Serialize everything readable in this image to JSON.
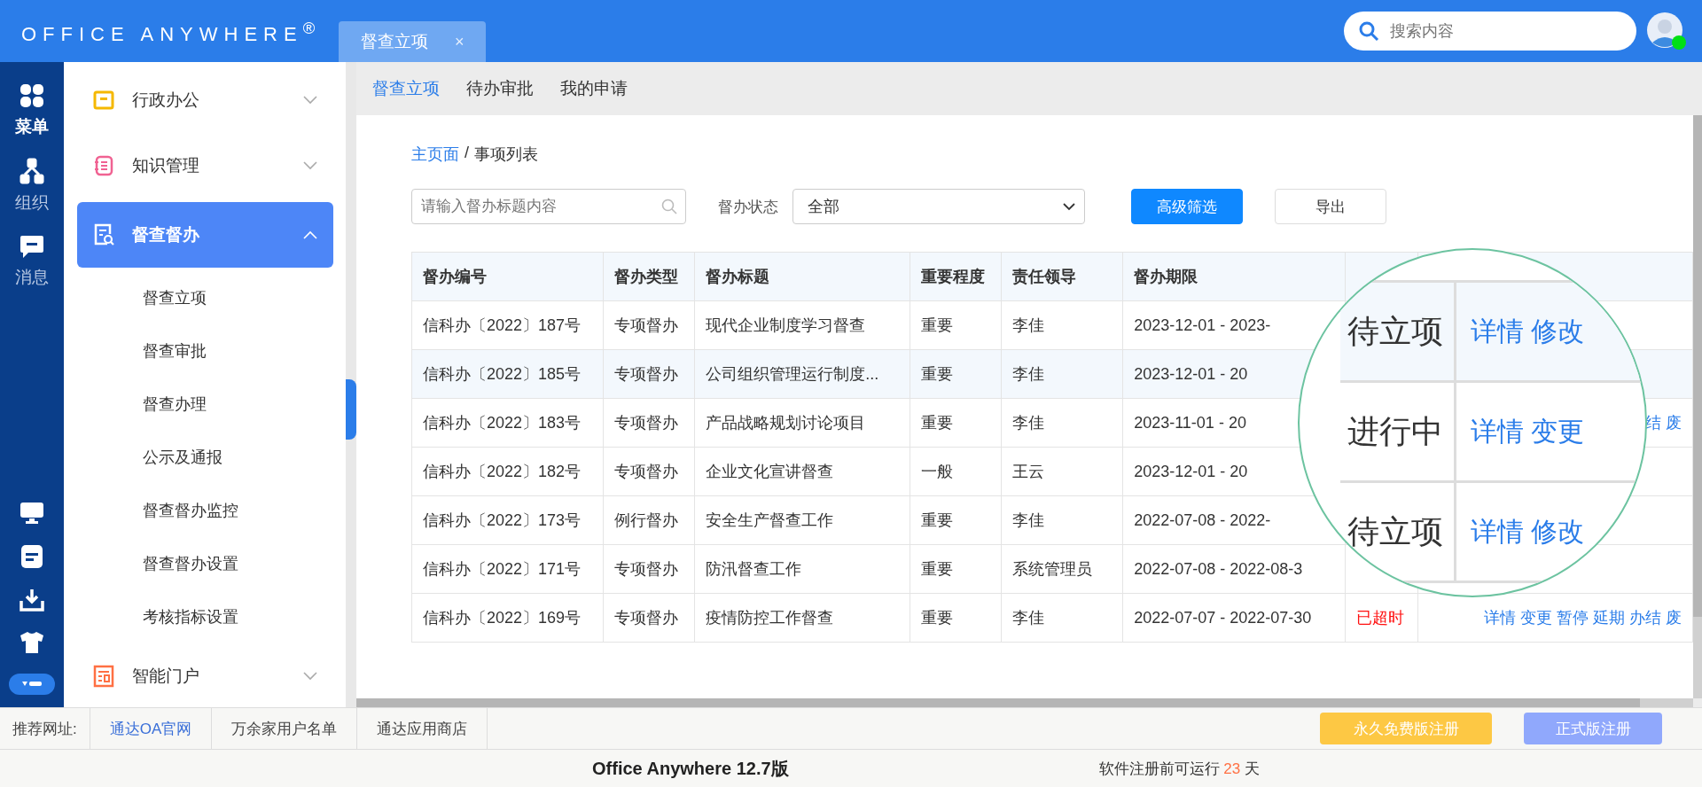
{
  "header": {
    "logo": "OFFICE ANYWHERE$^{®}$",
    "tab": {
      "label": "督查立项",
      "close": "×"
    },
    "search": {
      "placeholder": "搜索内容"
    },
    "avatar": {
      "online": true
    }
  },
  "rail": {
    "items": [
      {
        "label": "菜单",
        "selected": true
      },
      {
        "label": "组织",
        "selected": false
      },
      {
        "label": "消息",
        "selected": false
      }
    ]
  },
  "sidebar": {
    "items": [
      {
        "label": "行政办公",
        "expanded": false,
        "selected": false
      },
      {
        "label": "知识管理",
        "expanded": false,
        "selected": false
      },
      {
        "label": "督查督办",
        "expanded": true,
        "selected": true,
        "children": [
          {
            "label": "督查立项"
          },
          {
            "label": "督查审批"
          },
          {
            "label": "督查办理"
          },
          {
            "label": "公示及通报"
          },
          {
            "label": "督查督办监控"
          },
          {
            "label": "督查督办设置"
          },
          {
            "label": "考核指标设置"
          }
        ]
      },
      {
        "label": "智能门户",
        "expanded": false,
        "selected": false
      }
    ]
  },
  "subtabs": [
    {
      "label": "督查立项",
      "selected": true
    },
    {
      "label": "待办审批",
      "selected": false
    },
    {
      "label": "我的申请",
      "selected": false
    }
  ],
  "breadcrumb": [
    {
      "label": "主页面",
      "link": true
    },
    {
      "label": "/",
      "link": false
    },
    {
      "label": "事项列表",
      "link": false
    }
  ],
  "filters": {
    "search": {
      "placeholder": "请输入督办标题内容"
    },
    "status_label": "督办状态",
    "status_select": "全部",
    "buttons": [
      {
        "label": "高级筛选",
        "primary": true
      },
      {
        "label": "导出",
        "primary": false
      }
    ]
  },
  "table": {
    "columns": [
      "督办编号",
      "督办类型",
      "督办标题",
      "重要程度",
      "责任领导",
      "督办期限"
    ],
    "rows": [
      {
        "selected": false,
        "cells": [
          "信科办〔2022〕187号",
          "专项督办",
          "现代企业制度学习督查",
          "重要",
          "李佳",
          "2023-12-01 - 2023-"
        ]
      },
      {
        "selected": true,
        "cells": [
          "信科办〔2022〕185号",
          "专项督办",
          "公司组织管理运行制度...",
          "重要",
          "李佳",
          "2023-12-01 - 20"
        ]
      },
      {
        "selected": false,
        "cells": [
          "信科办〔2022〕183号",
          "专项督办",
          "产品战略规划讨论项目",
          "重要",
          "李佳",
          "2023-11-01 - 20"
        ],
        "actions": "结 废"
      },
      {
        "selected": false,
        "cells": [
          "信科办〔2022〕182号",
          "专项督办",
          "企业文化宣讲督查",
          "一般",
          "王云",
          "2023-12-01 - 20"
        ]
      },
      {
        "selected": false,
        "cells": [
          "信科办〔2022〕173号",
          "例行督办",
          "安全生产督查工作",
          "重要",
          "李佳",
          "2022-07-08 - 2022-"
        ]
      },
      {
        "selected": false,
        "cells": [
          "信科办〔2022〕171号",
          "专项督办",
          "防汛督查工作",
          "重要",
          "系统管理员",
          "2022-07-08 - 2022-08-3"
        ]
      },
      {
        "selected": false,
        "cells": [
          "信科办〔2022〕169号",
          "专项督办",
          "疫情防控工作督查",
          "重要",
          "李佳",
          "2022-07-07 - 2022-07-30"
        ],
        "status": "已超时",
        "overdue": true,
        "actions": "详情 变更 暂停 延期 办结 废"
      }
    ]
  },
  "magnifier": {
    "rows": [
      {
        "status": "待立项",
        "actions": "详情 修改"
      },
      {
        "status": "进行中",
        "actions": "详情 变更"
      },
      {
        "status": "待立项",
        "actions": "详情 修改"
      }
    ]
  },
  "links_bar": {
    "label": "推荐网址:",
    "links": [
      {
        "label": "通达OA官网",
        "active": true
      },
      {
        "label": "万余家用户名单",
        "active": false
      },
      {
        "label": "通达应用商店",
        "active": false
      }
    ],
    "buttons": [
      {
        "label": "永久免费版注册",
        "kind": "free"
      },
      {
        "label": "正式版注册",
        "kind": "pro"
      }
    ]
  },
  "footer": {
    "product": "Office Anywhere 12.7版",
    "trial_prefix": "软件注册前可运行",
    "days": "23",
    "trial_suffix": "天"
  }
}
